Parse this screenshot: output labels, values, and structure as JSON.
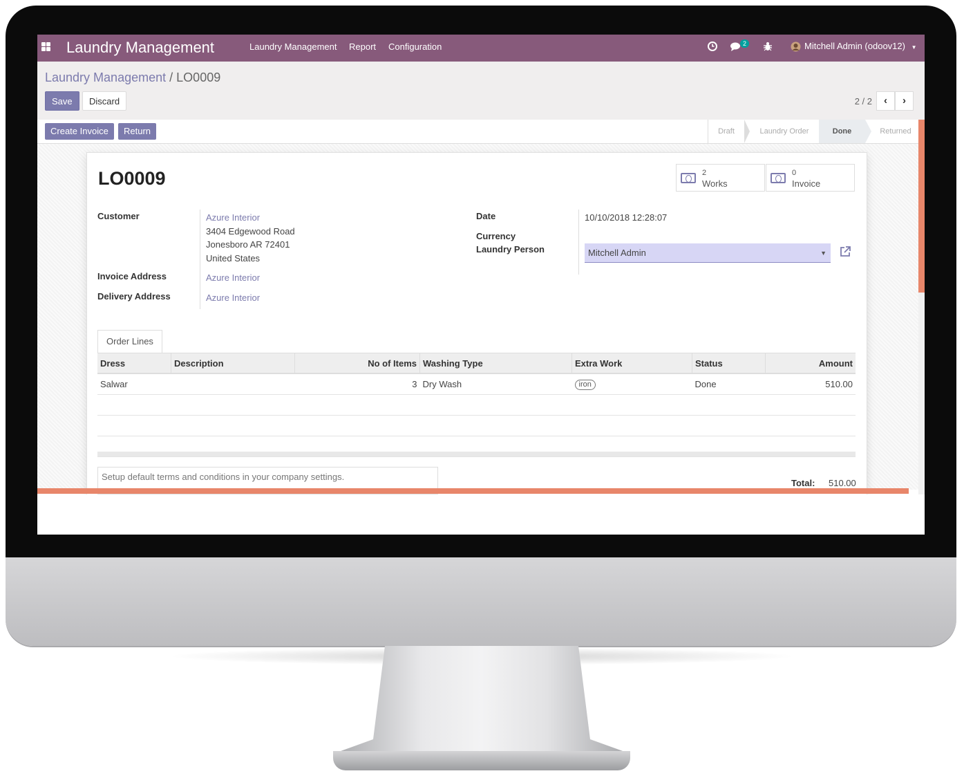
{
  "navbar": {
    "app_title": "Laundry Management",
    "menus": [
      "Laundry Management",
      "Report",
      "Configuration"
    ],
    "messages_badge": "2",
    "user": "Mitchell Admin (odoov12)",
    "brand_color": "#875a7b"
  },
  "breadcrumb": {
    "root": "Laundry Management",
    "separator": "/",
    "current": "LO0009"
  },
  "actions": {
    "save": "Save",
    "discard": "Discard"
  },
  "pager": {
    "text": "2 / 2"
  },
  "statusbar": {
    "buttons": [
      "Create Invoice",
      "Return"
    ],
    "stages": [
      "Draft",
      "Laundry Order",
      "Done",
      "Returned"
    ],
    "active_stage": "Done"
  },
  "record": {
    "name": "LO0009",
    "smart_buttons": [
      {
        "count": "2",
        "label": "Works",
        "icon": "money-icon"
      },
      {
        "count": "0",
        "label": "Invoice",
        "icon": "money-icon"
      }
    ],
    "labels": {
      "customer": "Customer",
      "invoice_address": "Invoice Address",
      "delivery_address": "Delivery Address",
      "date": "Date",
      "currency": "Currency",
      "laundry_person": "Laundry Person"
    },
    "customer": {
      "name": "Azure Interior",
      "street": "3404 Edgewood Road",
      "city": "Jonesboro AR 72401",
      "country": "United States"
    },
    "invoice_address": "Azure Interior",
    "delivery_address": "Azure Interior",
    "date": "10/10/2018 12:28:07",
    "laundry_person": "Mitchell Admin"
  },
  "tabs": [
    "Order Lines"
  ],
  "table": {
    "headers": [
      "Dress",
      "Description",
      "No of Items",
      "Washing Type",
      "Extra Work",
      "Status",
      "Amount"
    ],
    "rows": [
      {
        "dress": "Salwar",
        "description": "",
        "items": "3",
        "washing_type": "Dry Wash",
        "extra_work": "iron",
        "status": "Done",
        "amount": "510.00"
      }
    ]
  },
  "terms_placeholder": "Setup default terms and conditions in your company settings.",
  "total": {
    "label": "Total:",
    "value": "510.00"
  }
}
